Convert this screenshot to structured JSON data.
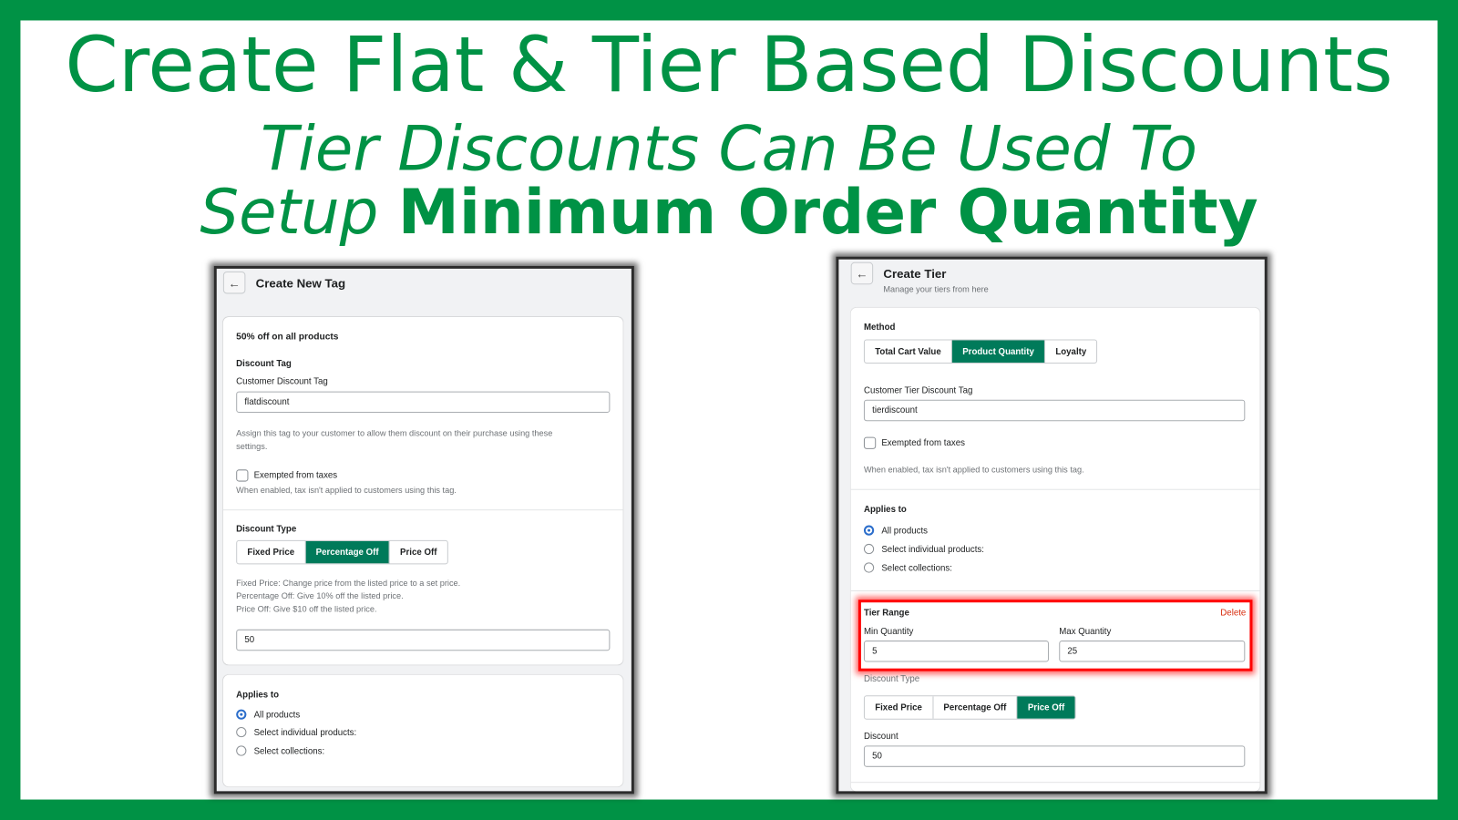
{
  "banner": {
    "title": "Create Flat & Tier Based Discounts",
    "subtitle_line1": "Tier Discounts Can Be Used To",
    "subtitle_line2_italic": "Setup",
    "subtitle_line2_bold": "Minimum Order Quantity",
    "brand_color": "#009245"
  },
  "left_panel": {
    "title": "Create New Tag",
    "card_heading": "50% off on all products",
    "discount_tag_section": "Discount Tag",
    "tag_field_label": "Customer Discount Tag",
    "tag_field_value": "flatdiscount",
    "tag_hint_line1": "Assign this tag to your customer to allow them discount on their purchase using these",
    "tag_hint_line2": "settings.",
    "exempt_label": "Exempted from taxes",
    "exempt_checked": false,
    "exempt_hint": "When enabled, tax isn't applied to customers using this tag.",
    "discount_type_label": "Discount Type",
    "discount_types": [
      "Fixed Price",
      "Percentage Off",
      "Price Off"
    ],
    "discount_type_selected": "Percentage Off",
    "discount_hint_lines": [
      "Fixed Price: Change price from the listed price to a set price.",
      "Percentage Off: Give 10% off the listed price.",
      "Price Off: Give $10 off the listed price."
    ],
    "discount_value": "50",
    "applies_to_label": "Applies to",
    "applies_to_options": [
      "All products",
      "Select individual products:",
      "Select collections:"
    ],
    "applies_to_selected": "All products"
  },
  "right_panel": {
    "title": "Create Tier",
    "subtitle": "Manage your tiers from here",
    "method_label": "Method",
    "methods": [
      "Total Cart Value",
      "Product Quantity",
      "Loyalty"
    ],
    "method_selected": "Product Quantity",
    "tag_field_label": "Customer Tier Discount Tag",
    "tag_field_value": "tierdiscount",
    "exempt_label": "Exempted from taxes",
    "exempt_checked": false,
    "exempt_hint": "When enabled, tax isn't applied to customers using this tag.",
    "applies_to_label": "Applies to",
    "applies_to_options": [
      "All products",
      "Select individual products:",
      "Select collections:"
    ],
    "applies_to_selected": "All products",
    "tier_range_label": "Tier Range",
    "delete_label": "Delete",
    "min_qty_label": "Min Quantity",
    "min_qty_value": "5",
    "max_qty_label": "Max Quantity",
    "max_qty_value": "25",
    "discount_type_label": "Discount Type",
    "discount_types": [
      "Fixed Price",
      "Percentage Off",
      "Price Off"
    ],
    "discount_type_selected": "Price Off",
    "discount_label": "Discount",
    "discount_value": "50",
    "accent_color": "#007a5a",
    "highlight_color": "#ff0000"
  }
}
